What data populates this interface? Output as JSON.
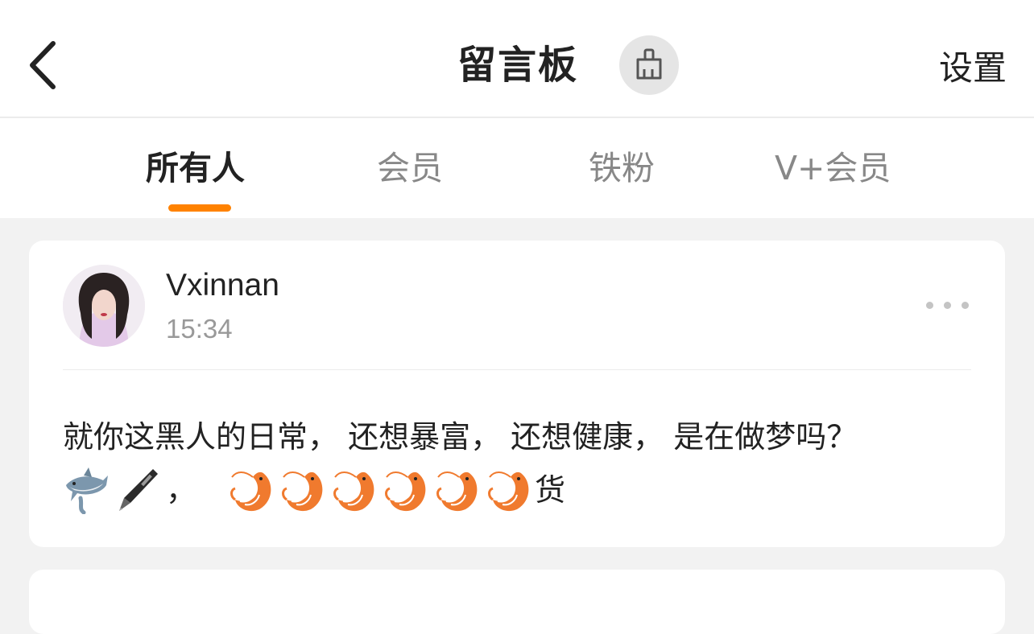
{
  "header": {
    "back_icon": "chevron-left-icon",
    "title": "留言板",
    "clean_icon": "broom-icon",
    "settings_label": "设置"
  },
  "tabs": [
    {
      "label": "所有人",
      "active": true
    },
    {
      "label": "会员",
      "active": false
    },
    {
      "label": "铁粉",
      "active": false
    },
    {
      "label": "V+会员",
      "active": false
    }
  ],
  "colors": {
    "accent": "#ff8200",
    "background": "#f2f2f2"
  },
  "messages": [
    {
      "username": "Vxinnan",
      "time": "15:34",
      "text": "就你这黑人的日常， 还想暴富， 还想健康， 是在做梦吗？",
      "emoji_line": {
        "emojis_before_comma": [
          "shark-emoji",
          "pen-emoji"
        ],
        "comma": "，",
        "repeated_emoji": "shrimp-emoji",
        "repeat_count": 6,
        "suffix": "货"
      }
    }
  ]
}
